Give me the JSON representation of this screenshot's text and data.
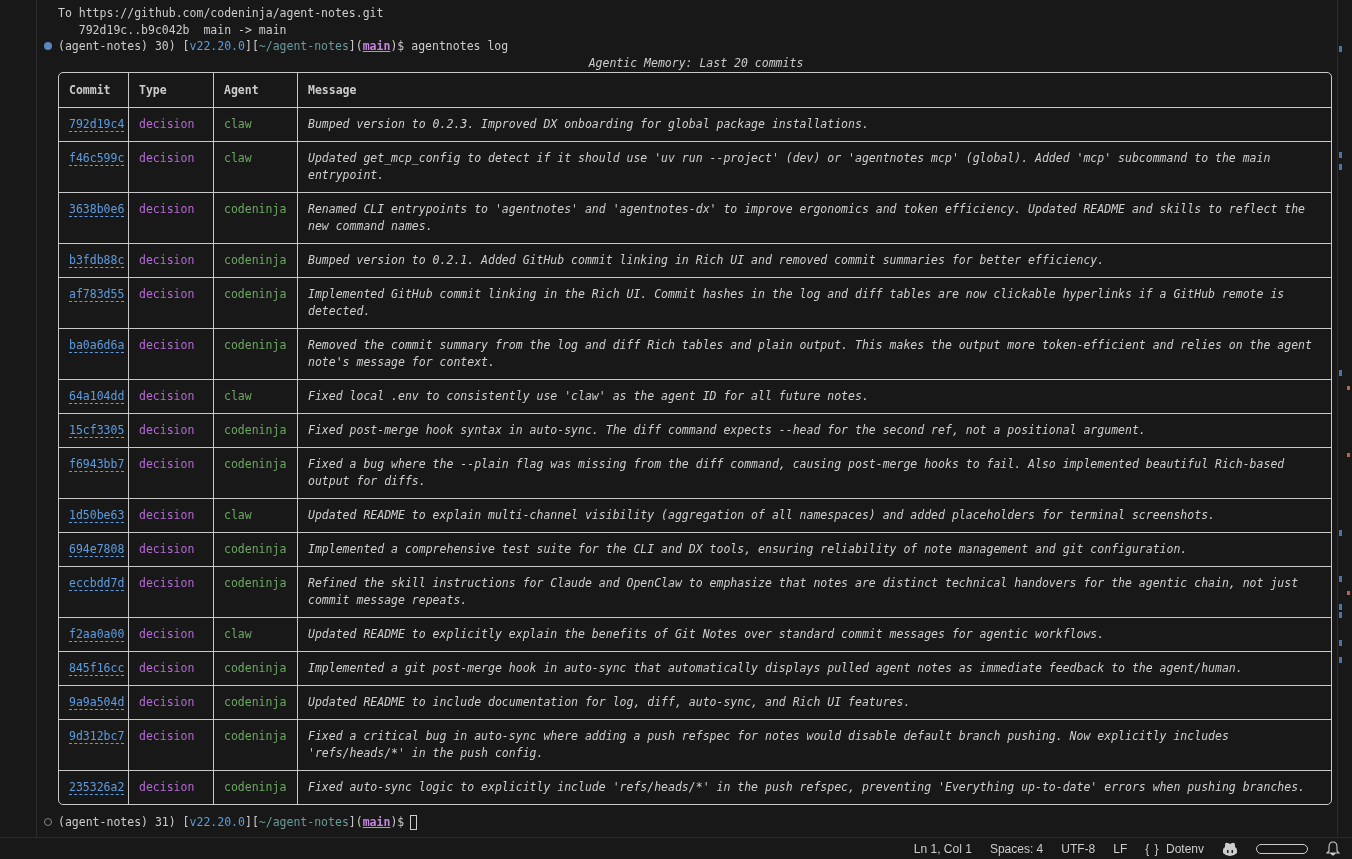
{
  "output_lines": [
    "To https://github.com/codeninja/agent-notes.git",
    "   792d19c..b9c042b  main -> main"
  ],
  "prompt": {
    "done": true,
    "segments": [
      {
        "kind": "plain",
        "text": "(agent-notes) 30) ["
      },
      {
        "kind": "version",
        "text": "v22.20.0"
      },
      {
        "kind": "plain",
        "text": "]["
      },
      {
        "kind": "path",
        "text": "~/agent-notes"
      },
      {
        "kind": "plain",
        "text": "]("
      },
      {
        "kind": "branch",
        "text": "main"
      },
      {
        "kind": "plain",
        "text": ")$"
      }
    ],
    "command": "agentnotes log"
  },
  "table": {
    "title": "Agentic Memory: Last 20 commits",
    "columns": [
      "Commit",
      "Type",
      "Agent",
      "Message"
    ],
    "rows": [
      {
        "commit": "792d19c4",
        "type": "decision",
        "agent": "claw",
        "message": "Bumped version to 0.2.3. Improved DX onboarding for global package installations."
      },
      {
        "commit": "f46c599c",
        "type": "decision",
        "agent": "claw",
        "message": "Updated get_mcp_config to detect if it should use 'uv run --project' (dev) or 'agentnotes mcp' (global). Added 'mcp' subcommand to the main entrypoint."
      },
      {
        "commit": "3638b0e6",
        "type": "decision",
        "agent": "codeninja",
        "message": "Renamed CLI entrypoints to 'agentnotes' and 'agentnotes-dx' to improve ergonomics and token efficiency. Updated README and skills to reflect the new command names."
      },
      {
        "commit": "b3fdb88c",
        "type": "decision",
        "agent": "codeninja",
        "message": "Bumped version to 0.2.1. Added GitHub commit linking in Rich UI and removed commit summaries for better efficiency."
      },
      {
        "commit": "af783d55",
        "type": "decision",
        "agent": "codeninja",
        "message": "Implemented GitHub commit linking in the Rich UI. Commit hashes in the log and diff tables are now clickable hyperlinks if a GitHub remote is detected."
      },
      {
        "commit": "ba0a6d6a",
        "type": "decision",
        "agent": "codeninja",
        "message": "Removed the commit summary from the log and diff Rich tables and plain output. This makes the output more token-efficient and relies on the agent note's message for context."
      },
      {
        "commit": "64a104dd",
        "type": "decision",
        "agent": "claw",
        "message": "Fixed local .env to consistently use 'claw' as the agent ID for all future notes."
      },
      {
        "commit": "15cf3305",
        "type": "decision",
        "agent": "codeninja",
        "message": "Fixed post-merge hook syntax in auto-sync. The diff command expects --head for the second ref, not a positional argument."
      },
      {
        "commit": "f6943bb7",
        "type": "decision",
        "agent": "codeninja",
        "message": "Fixed a bug where the --plain flag was missing from the diff command, causing post-merge hooks to fail. Also implemented beautiful Rich-based output for diffs."
      },
      {
        "commit": "1d50be63",
        "type": "decision",
        "agent": "claw",
        "message": "Updated README to explain multi-channel visibility (aggregation of all namespaces) and added placeholders for terminal screenshots."
      },
      {
        "commit": "694e7808",
        "type": "decision",
        "agent": "codeninja",
        "message": "Implemented a comprehensive test suite for the CLI and DX tools, ensuring reliability of note management and git configuration."
      },
      {
        "commit": "eccbdd7d",
        "type": "decision",
        "agent": "codeninja",
        "message": "Refined the skill instructions for Claude and OpenClaw to emphasize that notes are distinct technical handovers for the agentic chain, not just commit message repeats."
      },
      {
        "commit": "f2aa0a00",
        "type": "decision",
        "agent": "claw",
        "message": "Updated README to explicitly explain the benefits of Git Notes over standard commit messages for agentic workflows."
      },
      {
        "commit": "845f16cc",
        "type": "decision",
        "agent": "codeninja",
        "message": "Implemented a git post-merge hook in auto-sync that automatically displays pulled agent notes as immediate feedback to the agent/human."
      },
      {
        "commit": "9a9a504d",
        "type": "decision",
        "agent": "codeninja",
        "message": "Updated README to include documentation for log, diff, auto-sync, and Rich UI features."
      },
      {
        "commit": "9d312bc7",
        "type": "decision",
        "agent": "codeninja",
        "message": "Fixed a critical bug in auto-sync where adding a push refspec for notes would disable default branch pushing. Now explicitly includes 'refs/heads/*' in the push config."
      },
      {
        "commit": "235326a2",
        "type": "decision",
        "agent": "codeninja",
        "message": "Fixed auto-sync logic to explicitly include 'refs/heads/*' in the push refspec, preventing 'Everything up-to-date' errors when pushing branches."
      }
    ]
  },
  "prompt2": {
    "done": false,
    "segments": [
      {
        "kind": "plain",
        "text": "(agent-notes) 31) ["
      },
      {
        "kind": "version",
        "text": "v22.20.0"
      },
      {
        "kind": "plain",
        "text": "]["
      },
      {
        "kind": "path",
        "text": "~/agent-notes"
      },
      {
        "kind": "plain",
        "text": "]("
      },
      {
        "kind": "branch",
        "text": "main"
      },
      {
        "kind": "plain",
        "text": ")$"
      }
    ]
  },
  "status_bar": {
    "items": [
      "Ln 1, Col 1",
      "Spaces: 4",
      "UTF-8",
      "LF"
    ],
    "language": {
      "icon": "{ }",
      "label": "Dotenv"
    }
  }
}
